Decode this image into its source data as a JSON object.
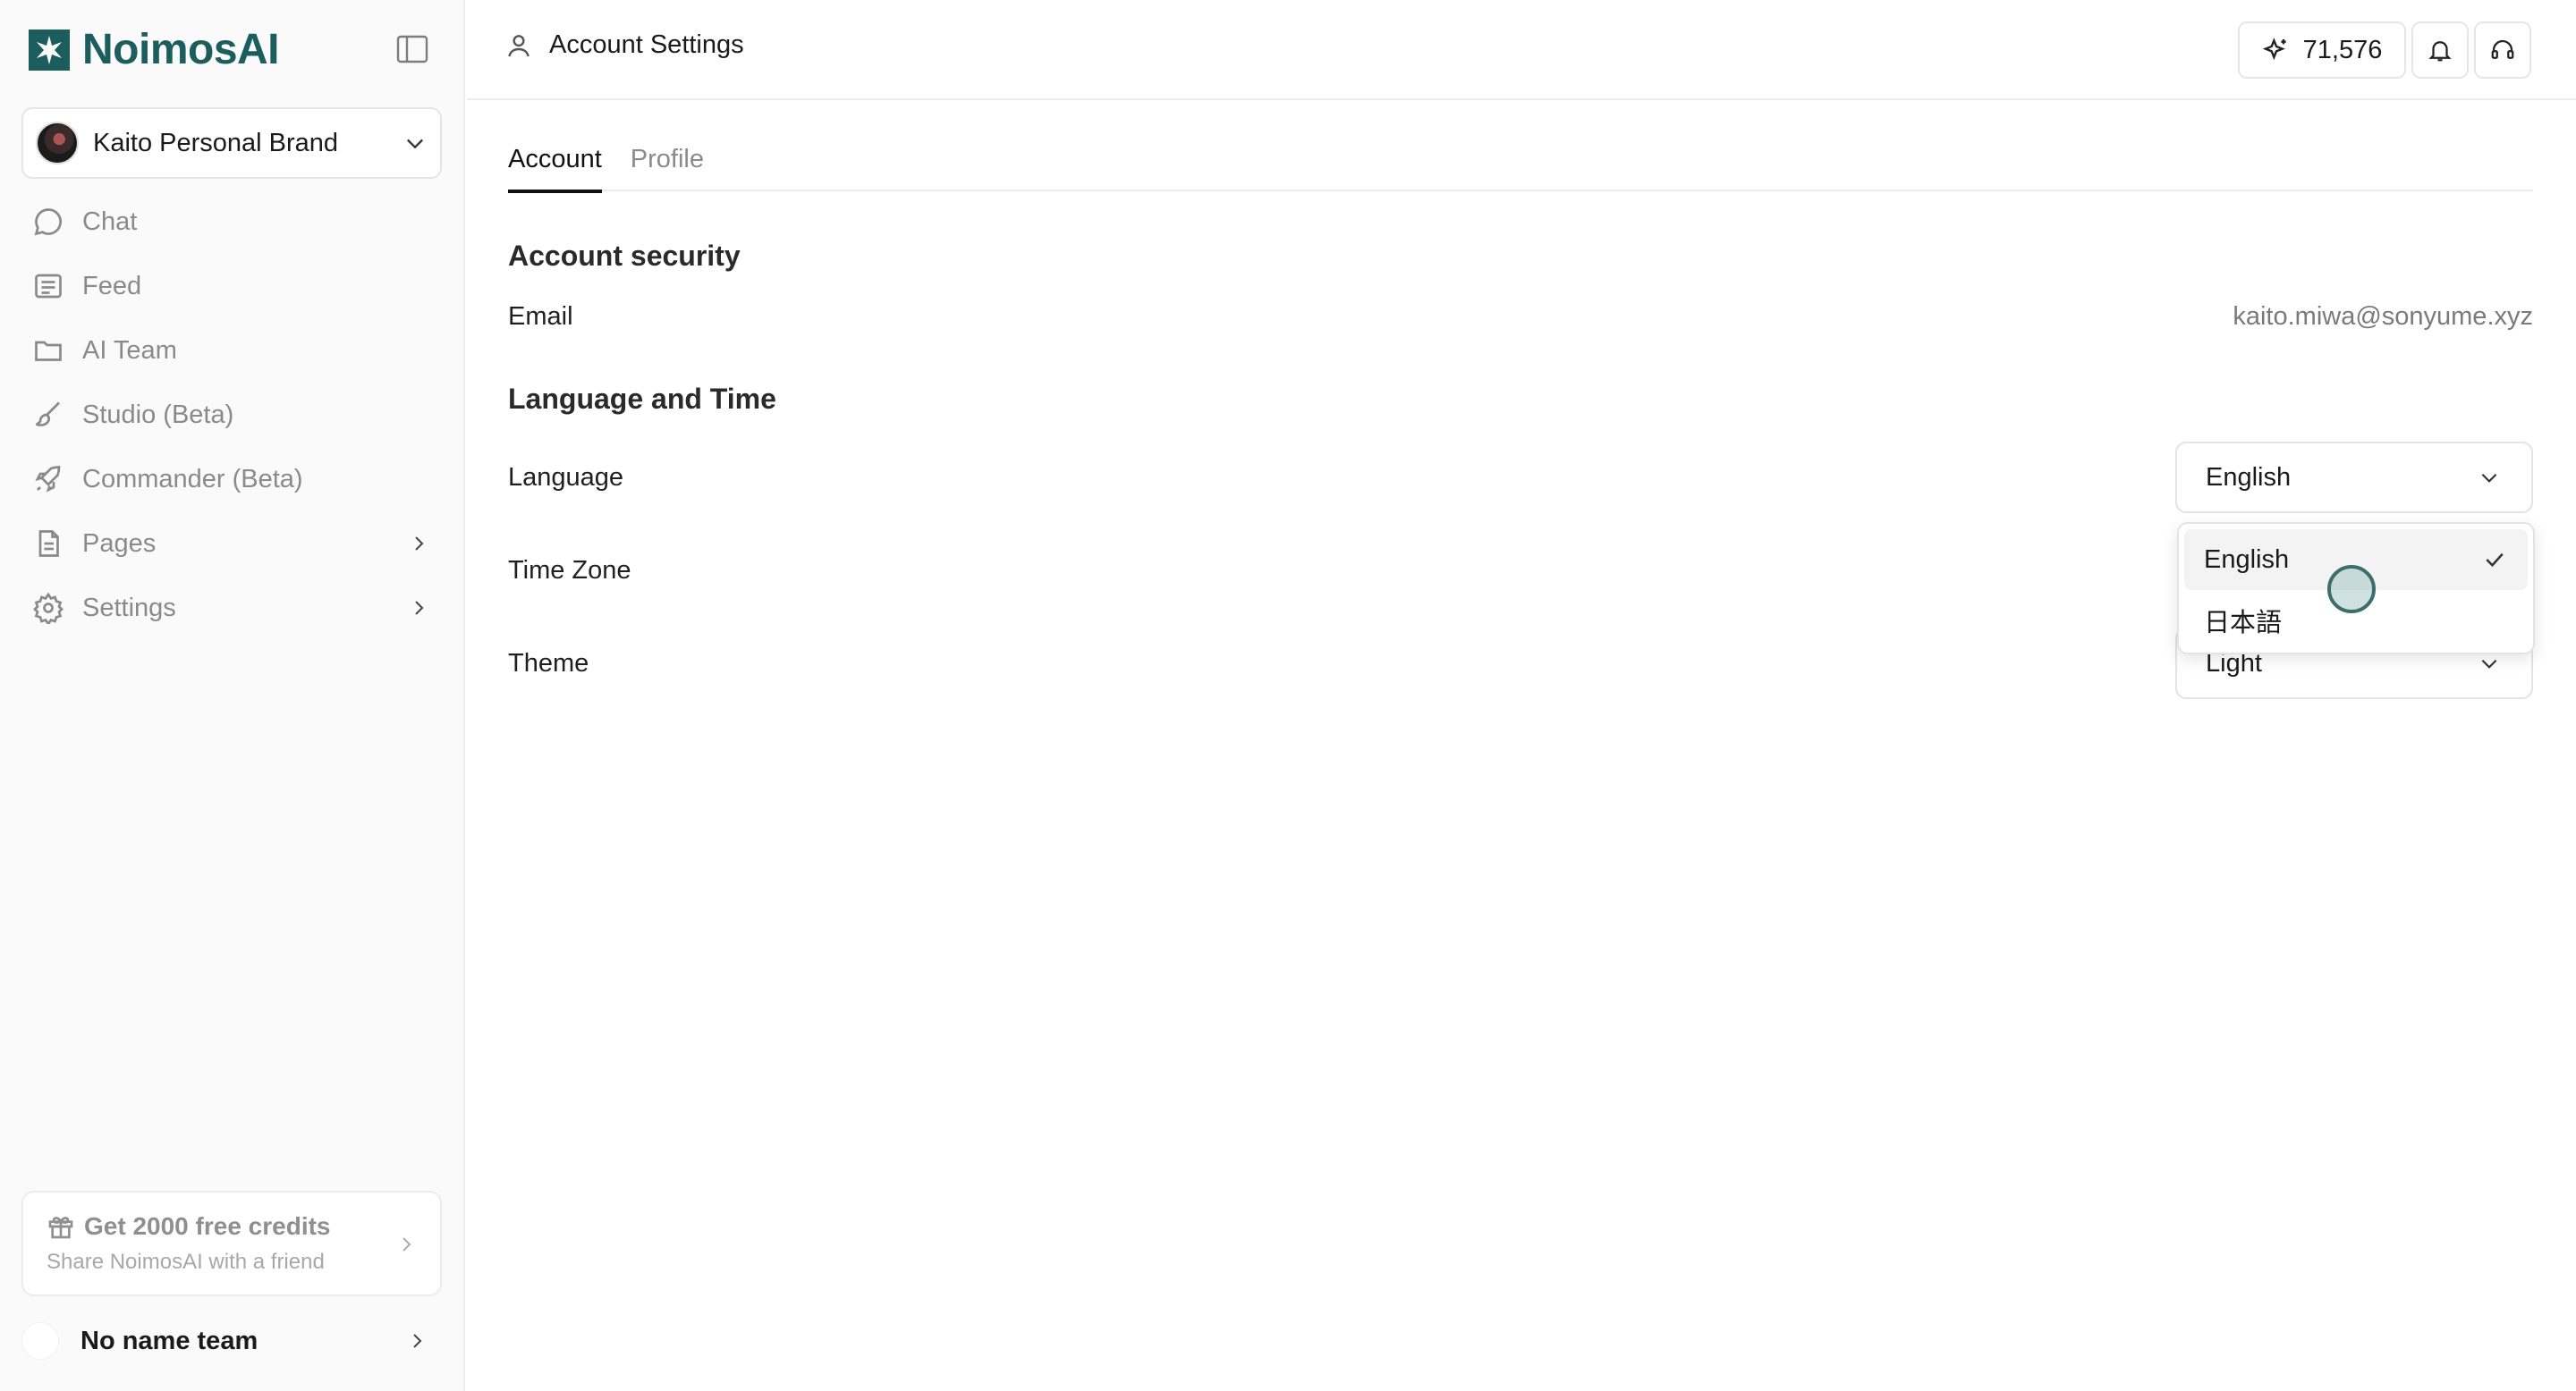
{
  "brand": {
    "name": "NoimosAI",
    "color": "#1c5e5e"
  },
  "workspace": {
    "name": "Kaito Personal Brand"
  },
  "nav": [
    {
      "label": "Chat",
      "icon": "chat-bubble-icon"
    },
    {
      "label": "Feed",
      "icon": "newspaper-icon"
    },
    {
      "label": "AI Team",
      "icon": "folder-icon"
    },
    {
      "label": "Studio (Beta)",
      "icon": "brush-icon"
    },
    {
      "label": "Commander (Beta)",
      "icon": "rocket-icon"
    },
    {
      "label": "Pages",
      "icon": "file-icon",
      "has_submenu": true
    },
    {
      "label": "Settings",
      "icon": "gear-icon",
      "has_submenu": true
    }
  ],
  "promo": {
    "title": "Get 2000 free credits",
    "subtitle": "Share NoimosAI with a friend"
  },
  "team": {
    "name": "No name team"
  },
  "header": {
    "title": "Account Settings",
    "credits": "71,576"
  },
  "tabs": [
    {
      "label": "Account",
      "active": true
    },
    {
      "label": "Profile",
      "active": false
    }
  ],
  "account_security": {
    "title": "Account security",
    "email_label": "Email",
    "email_value": "kaito.miwa@sonyume.xyz"
  },
  "language_time": {
    "title": "Language and Time",
    "language_label": "Language",
    "language_value": "English",
    "timezone_label": "Time Zone",
    "theme_label": "Theme",
    "theme_value": "Light"
  },
  "language_dropdown": {
    "options": [
      {
        "label": "English",
        "selected": true
      },
      {
        "label": "日本語",
        "selected": false
      }
    ]
  }
}
